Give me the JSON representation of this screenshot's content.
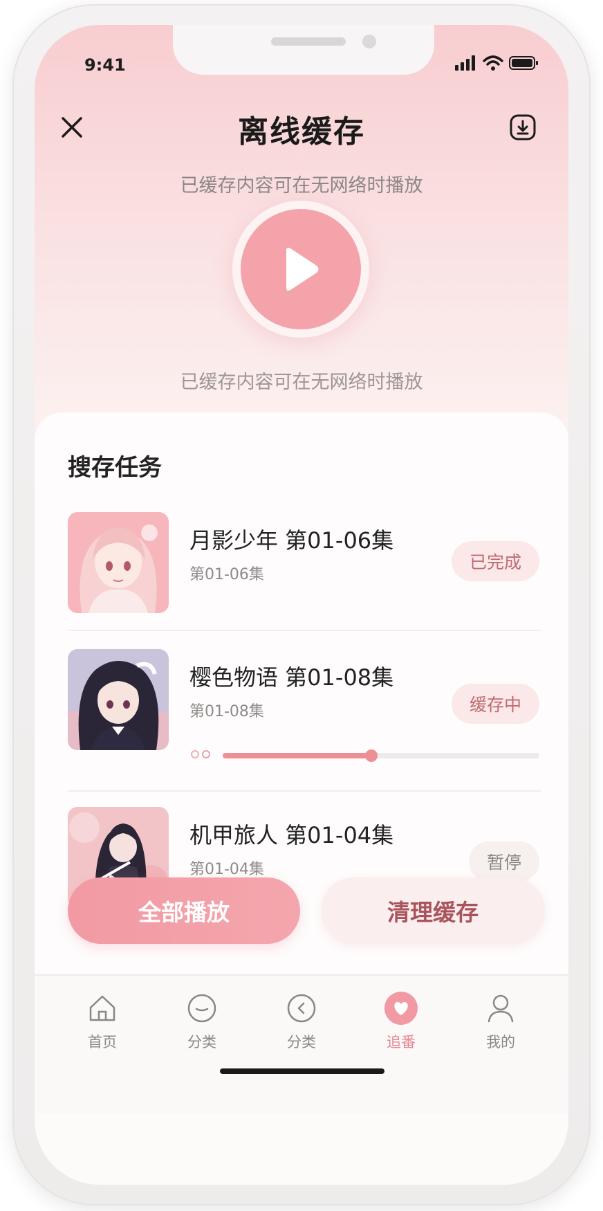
{
  "status_bar": {
    "time": "9:41"
  },
  "header": {
    "title": "离线缓存",
    "subtitle": "已缓存内容可在无网络时播放",
    "caption": "已缓存内容可在无网络时播放"
  },
  "tasks_section": {
    "title": "搜存任务",
    "items": [
      {
        "title": "月影少年 第01-06集",
        "subtitle": "第01-06集",
        "status": "已完成"
      },
      {
        "title": "樱色物语 第01-08集",
        "subtitle": "第01-08集",
        "status": "缓存中",
        "progress_percent": 47
      },
      {
        "title": "机甲旅人 第01-04集",
        "subtitle": "第01-04集",
        "status": "暂停"
      }
    ]
  },
  "actions": {
    "play_all": "全部播放",
    "clear_cache": "清理缓存"
  },
  "tabbar": {
    "items": [
      {
        "label": "首页",
        "icon": "home-icon"
      },
      {
        "label": "分类",
        "icon": "category-icon"
      },
      {
        "label": "分类",
        "icon": "category-back-icon"
      },
      {
        "label": "追番",
        "icon": "heart-icon",
        "active": true
      },
      {
        "label": "我的",
        "icon": "profile-icon"
      }
    ]
  },
  "colors": {
    "accent": "#f4a3aa",
    "accent_dark": "#c06a72",
    "hero_top": "#f8cdd0",
    "text_primary": "#222222"
  }
}
